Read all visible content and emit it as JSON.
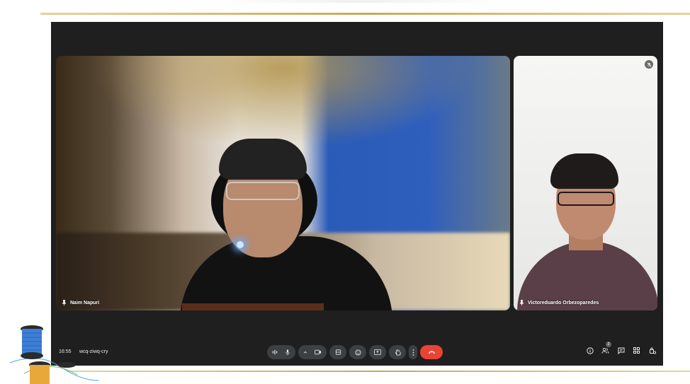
{
  "meeting": {
    "time": "16:55",
    "code": "wcq-ziwq-cry"
  },
  "participants": [
    {
      "name": "Naim Napuri",
      "role": "main"
    },
    {
      "name": "Victoreduardo Orbezoparedes",
      "role": "side"
    }
  ],
  "toolbar": {
    "icons": [
      "audio-levels-icon",
      "mic-icon",
      "chevron-up-icon",
      "camera-icon",
      "captions-icon",
      "emoji-icon",
      "present-icon",
      "raise-hand-icon",
      "more-options-icon",
      "end-call-icon"
    ],
    "end_call_color": "#ea4335"
  },
  "right_panel": {
    "people_count": "2",
    "icons": [
      "info-icon",
      "people-icon",
      "chat-icon",
      "activities-icon",
      "host-controls-icon"
    ]
  },
  "colors": {
    "window_bg": "#1f1f1f",
    "button_bg": "#3c4043",
    "accent_gold": "#c9a85a"
  }
}
